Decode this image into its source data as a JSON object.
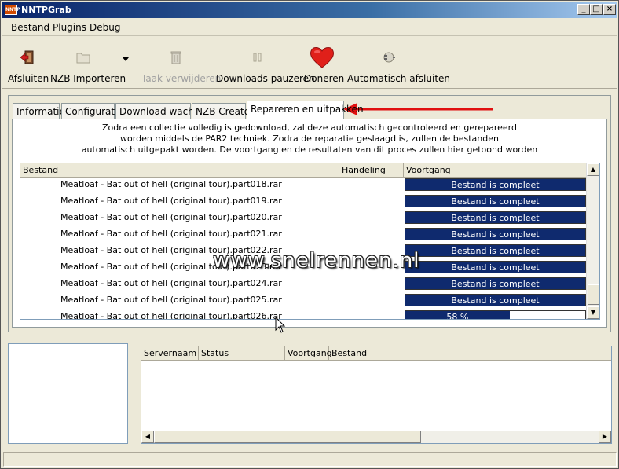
{
  "window": {
    "title": "NNTPGrab",
    "app_icon_text": "NNTP"
  },
  "menu": [
    "Bestand",
    "Plugins",
    "Debug"
  ],
  "toolbar": [
    {
      "label": "Afsluiten",
      "icon": "exit-icon",
      "enabled": true
    },
    {
      "label": "NZB Importeren",
      "icon": "folder-icon",
      "enabled": true
    },
    {
      "label": "Taak verwijderen",
      "icon": "trash-icon",
      "enabled": false
    },
    {
      "label": "Downloads pauzeren",
      "icon": "pause-icon",
      "enabled": true
    },
    {
      "label": "Doneren",
      "icon": "heart-icon",
      "enabled": true
    },
    {
      "label": "Automatisch afsluiten",
      "icon": "plug-icon",
      "enabled": true
    }
  ],
  "tabs": [
    "Informatie",
    "Configuratie",
    "Download wachtrij",
    "NZB Creator",
    "Repareren en uitpakken"
  ],
  "active_tab": "Repareren en uitpakken",
  "description": [
    "Zodra een collectie volledig is gedownload, zal deze automatisch gecontroleerd en gerepareerd",
    "worden middels de PAR2 techniek. Zodra de reparatie geslaagd is, zullen de bestanden",
    "automatisch uitgepakt worden. De voortgang en de resultaten van dit proces zullen hier getoond worden"
  ],
  "repair_list": {
    "columns": [
      "Bestand",
      "Handeling",
      "Voortgang"
    ],
    "rows": [
      {
        "file": "Meatloaf - Bat out of hell (original tour).part018.rar",
        "progress": 1.0,
        "progress_text": "Bestand is compleet"
      },
      {
        "file": "Meatloaf - Bat out of hell (original tour).part019.rar",
        "progress": 1.0,
        "progress_text": "Bestand is compleet"
      },
      {
        "file": "Meatloaf - Bat out of hell (original tour).part020.rar",
        "progress": 1.0,
        "progress_text": "Bestand is compleet"
      },
      {
        "file": "Meatloaf - Bat out of hell (original tour).part021.rar",
        "progress": 1.0,
        "progress_text": "Bestand is compleet"
      },
      {
        "file": "Meatloaf - Bat out of hell (original tour).part022.rar",
        "progress": 1.0,
        "progress_text": "Bestand is compleet"
      },
      {
        "file": "Meatloaf - Bat out of hell (original tour).part023.rar",
        "progress": 1.0,
        "progress_text": "Bestand is compleet"
      },
      {
        "file": "Meatloaf - Bat out of hell (original tour).part024.rar",
        "progress": 1.0,
        "progress_text": "Bestand is compleet"
      },
      {
        "file": "Meatloaf - Bat out of hell (original tour).part025.rar",
        "progress": 1.0,
        "progress_text": "Bestand is compleet"
      },
      {
        "file": "Meatloaf - Bat out of hell (original tour).part026.rar",
        "progress": 0.58,
        "progress_text": "58 %"
      }
    ]
  },
  "server_list": {
    "columns": [
      "Servernaam",
      "Status",
      "Voortgang",
      "Bestand"
    ]
  },
  "watermark": "www.snelrennen.nl",
  "colors": {
    "progress_fill": "#0f2a6e",
    "annotation_arrow": "#e01010",
    "heart": "#e0201a"
  }
}
